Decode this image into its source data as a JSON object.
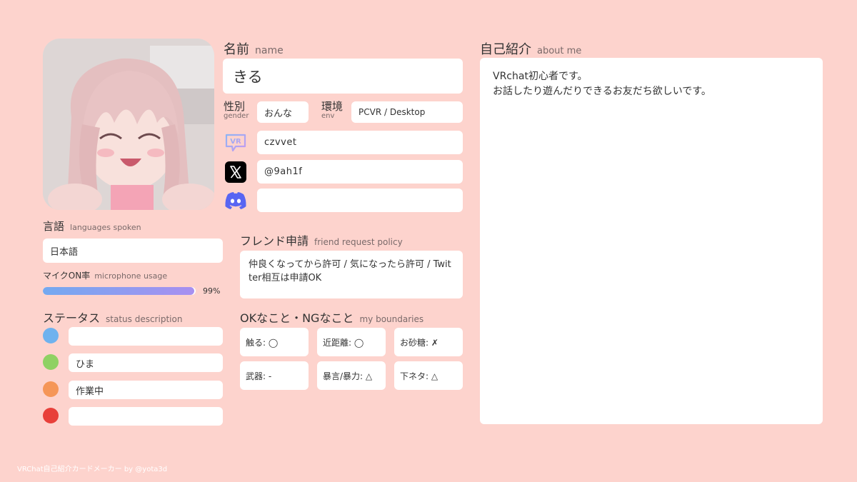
{
  "profile": {
    "name_label": "名前",
    "name_sub": "name",
    "name_value": "きる",
    "gender_label": "性別",
    "gender_sub": "gender",
    "gender_value": "おんな",
    "env_label": "環境",
    "env_sub": "env",
    "env_value": "PCVR / Desktop",
    "vrchat_id": "czvvet",
    "x_handle": "@9ah1f",
    "discord_id": ""
  },
  "languages": {
    "label": "言語",
    "sub": "languages spoken",
    "value": "日本語"
  },
  "mic": {
    "label": "マイクON率",
    "sub": "microphone usage",
    "percent_text": "99%",
    "fraction": 0.99
  },
  "status": {
    "label": "ステータス",
    "sub": "status description",
    "items": [
      {
        "color": "#6fb2ee",
        "text": ""
      },
      {
        "color": "#8fd163",
        "text": "ひま"
      },
      {
        "color": "#f59658",
        "text": "作業中"
      },
      {
        "color": "#e8403a",
        "text": ""
      }
    ]
  },
  "friend": {
    "label": "フレンド申請",
    "sub": "friend request policy",
    "text": "仲良くなってから許可 / 気になったら許可 / Twitter相互は申請OK"
  },
  "boundaries": {
    "label": "OKなこと・NGなこと",
    "sub": "my boundaries",
    "items": [
      "触る: ◯",
      "近距離: ◯",
      "お砂糖: ✗",
      "武器: -",
      "暴言/暴力: △",
      "下ネタ: △"
    ]
  },
  "about": {
    "label": "自己紹介",
    "sub": "about me",
    "lines": [
      "VRchat初心者です。",
      "お話したり遊んだりできるお友だち欲しいです。"
    ]
  },
  "footer": "VRChat自己紹介カードメーカー by @yota3d",
  "icons": {
    "vrchat": "vrchat-icon",
    "x": "x-logo-icon",
    "discord": "discord-icon"
  },
  "colors": {
    "background": "#fdd3cd",
    "box": "#ffffff",
    "mic_start": "#74a9f0",
    "mic_end": "#a88ff0",
    "discord": "#5865f2"
  }
}
